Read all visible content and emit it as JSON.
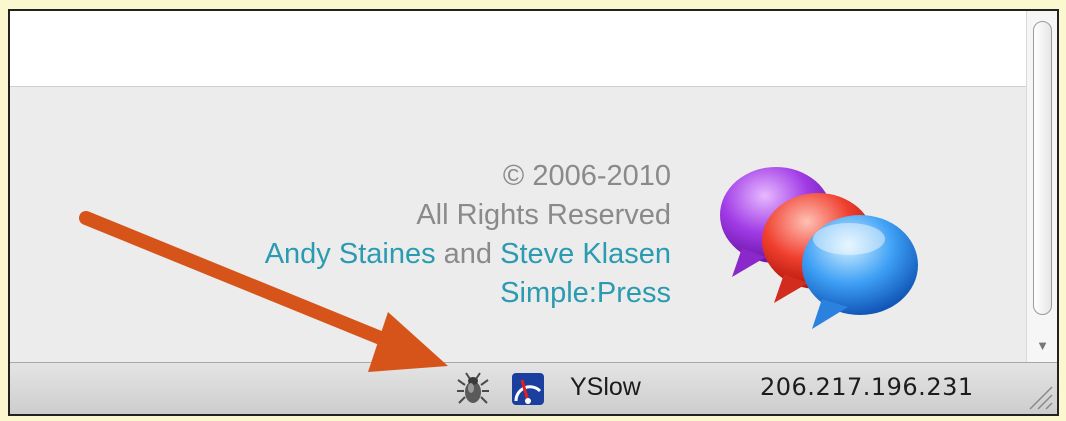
{
  "footer": {
    "copyright": "© 2006-2010",
    "rights": "All Rights Reserved",
    "author1": "Andy Staines",
    "conjunction": "and",
    "author2": "Steve Klasen",
    "product": "Simple:Press"
  },
  "statusbar": {
    "yslow_label": "YSlow",
    "ip_address": "206.217.196.231"
  },
  "icons": {
    "logo": "speech-bubbles-logo",
    "firebug": "firebug-bug-icon",
    "yslow": "yslow-speedometer-icon",
    "annotation": "orange-arrow"
  },
  "colors": {
    "link": "#2a9bb0",
    "text": "#8a8a8a",
    "arrow": "#d6541a",
    "background": "#fbf8d0"
  }
}
